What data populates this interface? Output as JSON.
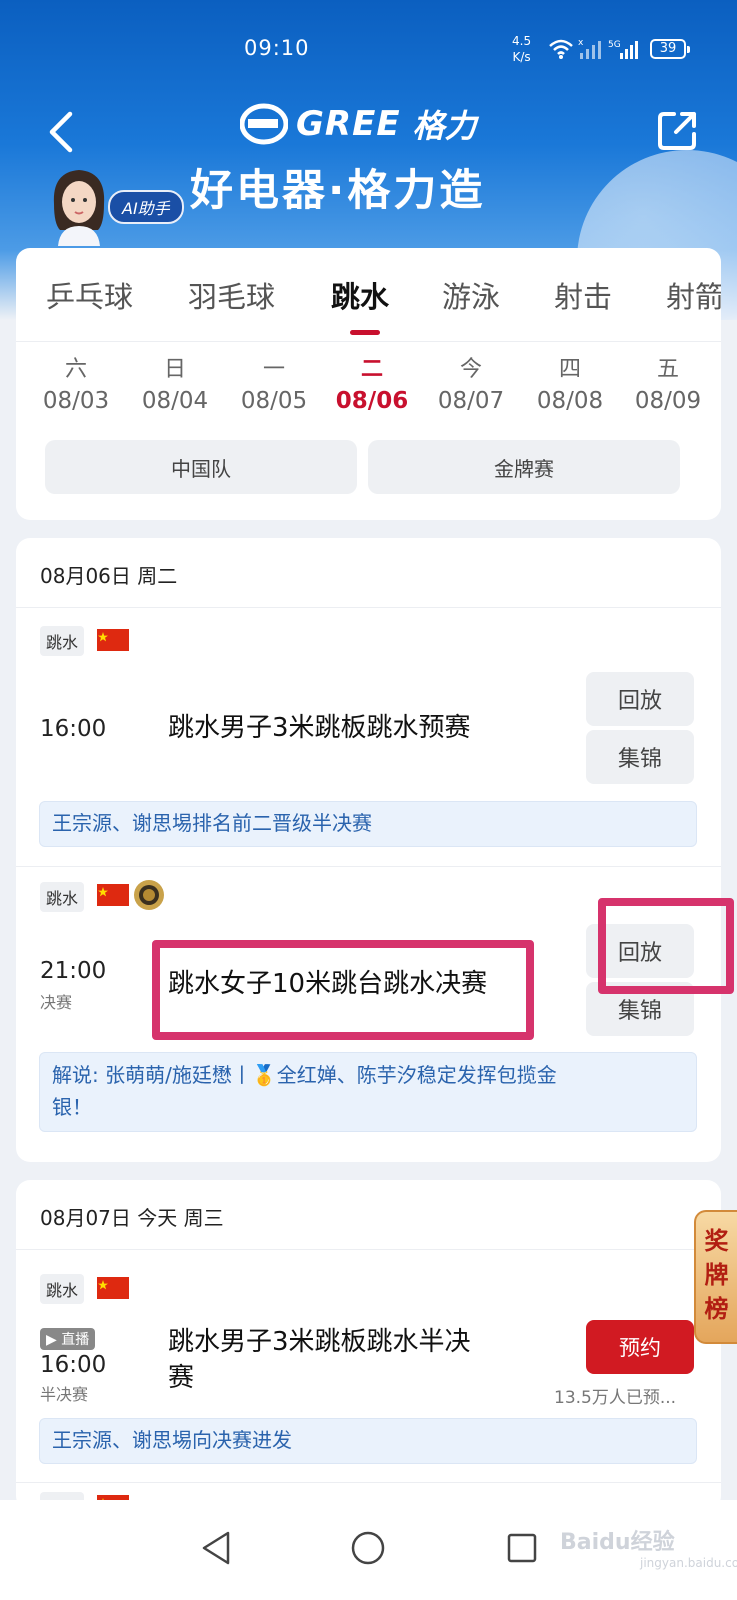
{
  "status_bar": {
    "time": "09:10",
    "net_speed_value": "4.5",
    "net_speed_unit": "K/s",
    "signal_label": "5G",
    "battery": "39"
  },
  "header": {
    "brand_text": "GREE",
    "brand_cn": "格力",
    "slogan": "好电器·格力造",
    "ai_badge": "AI助手"
  },
  "sport_tabs": [
    "乒乓球",
    "羽毛球",
    "跳水",
    "游泳",
    "射击",
    "射箭"
  ],
  "active_sport": "跳水",
  "dates": [
    {
      "weekday": "六",
      "date": "08/03"
    },
    {
      "weekday": "日",
      "date": "08/04"
    },
    {
      "weekday": "一",
      "date": "08/05"
    },
    {
      "weekday": "二",
      "date": "08/06"
    },
    {
      "weekday": "今",
      "date": "08/07"
    },
    {
      "weekday": "四",
      "date": "08/08"
    },
    {
      "weekday": "五",
      "date": "08/09"
    }
  ],
  "active_date": "08/06",
  "filters": [
    "中国队",
    "金牌赛"
  ],
  "day1": {
    "header": "08月06日 周二",
    "events": [
      {
        "sport": "跳水",
        "time": "16:00",
        "stage": "",
        "title": "跳水男子3米跳板跳水预赛",
        "buttons": [
          "回放",
          "集锦"
        ],
        "note": "王宗源、谢思埸排名前二晋级半决赛"
      },
      {
        "sport": "跳水",
        "time": "21:00",
        "stage": "决赛",
        "title": "跳水女子10米跳台跳水决赛",
        "buttons": [
          "回放",
          "集锦"
        ],
        "note_line1": "解说: 张萌萌/施廷懋丨🥇全红婵、陈芋汐稳定发挥包揽金",
        "note_line2": "银！"
      }
    ]
  },
  "day2": {
    "header": "08月07日 今天 周三",
    "events": [
      {
        "sport": "跳水",
        "live": "直播",
        "time": "16:00",
        "stage": "半决赛",
        "title_line1": "跳水男子3米跳板跳水半决",
        "title_line2": "赛",
        "button": "预约",
        "booked": "13.5万人已预...",
        "note": "王宗源、谢思埸向决赛进发"
      },
      {
        "sport": "跳水"
      }
    ]
  },
  "medal_tab": [
    "奖",
    "牌",
    "榜"
  ],
  "watermark": "Baidu经验",
  "watermark_sub": "jingyan.baidu.com",
  "colors": {
    "accent_red": "#c8102e",
    "highlight": "#d6336c",
    "header_blue": "#0b5fc0"
  }
}
